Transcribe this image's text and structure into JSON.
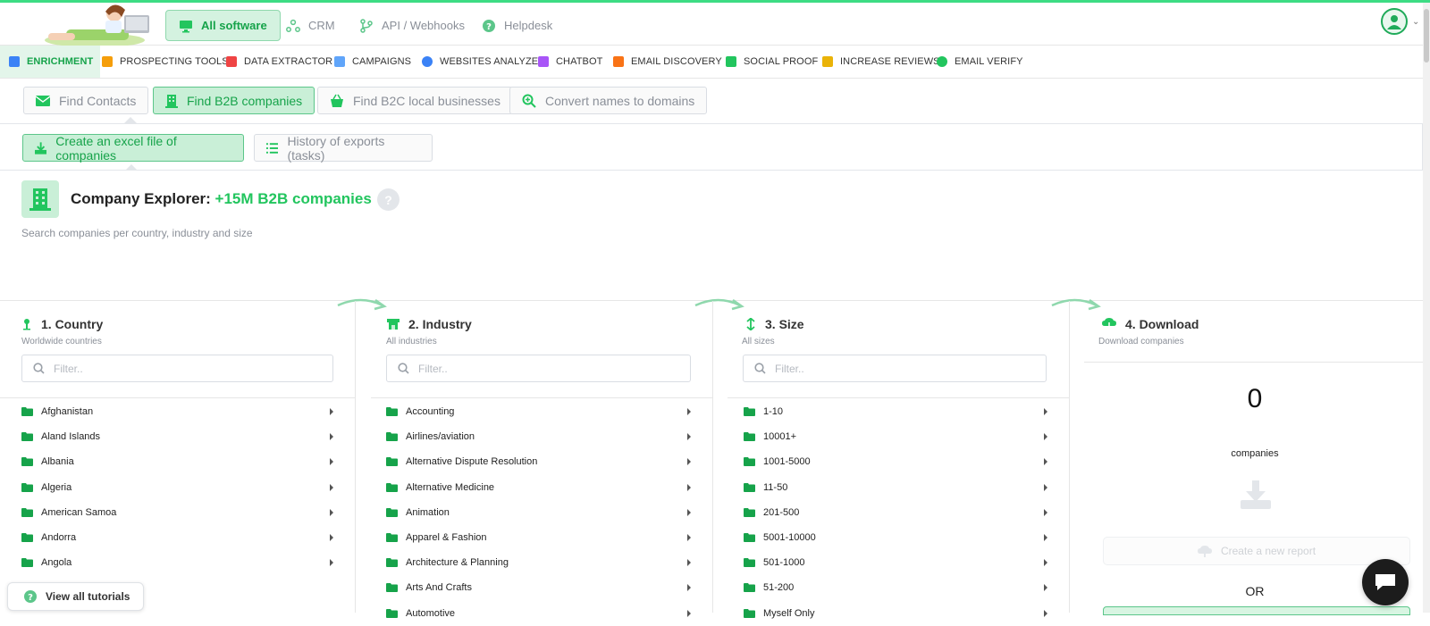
{
  "top_nav": {
    "tabs": [
      {
        "label": "All software",
        "icon": "monitor-icon",
        "active": true
      },
      {
        "label": "CRM",
        "icon": "users-network-icon",
        "active": false
      },
      {
        "label": "API / Webhooks",
        "icon": "branch-icon",
        "active": false
      },
      {
        "label": "Helpdesk",
        "icon": "question-icon",
        "active": false
      }
    ]
  },
  "sub_nav": {
    "items": [
      {
        "label": "ENRICHMENT",
        "color": "#3b82f6",
        "active": true
      },
      {
        "label": "PROSPECTING TOOLS",
        "color": "#f59e0b",
        "active": false
      },
      {
        "label": "DATA EXTRACTOR",
        "color": "#ef4444",
        "active": false
      },
      {
        "label": "CAMPAIGNS",
        "color": "#60a5fa",
        "active": false
      },
      {
        "label": "WEBSITES ANALYZE",
        "color": "#3b82f6",
        "active": false
      },
      {
        "label": "CHATBOT",
        "color": "#a855f7",
        "active": false
      },
      {
        "label": "EMAIL DISCOVERY",
        "color": "#f97316",
        "active": false
      },
      {
        "label": "SOCIAL PROOF",
        "color": "#22c55e",
        "active": false
      },
      {
        "label": "INCREASE REVIEWS",
        "color": "#eab308",
        "active": false
      },
      {
        "label": "EMAIL VERIFY",
        "color": "#22c55e",
        "active": false
      }
    ]
  },
  "tool_buttons": [
    {
      "label": "Find Contacts",
      "active": false
    },
    {
      "label": "Find B2B companies",
      "active": true
    },
    {
      "label": "Find B2C local businesses",
      "active": false
    },
    {
      "label": "Convert names to domains",
      "active": false
    }
  ],
  "action_buttons": [
    {
      "label": "Create an excel file of companies",
      "active": true
    },
    {
      "label": "History of exports (tasks)",
      "active": false
    }
  ],
  "explorer": {
    "title": "Company Explorer:",
    "highlight": "+15M B2B companies",
    "help": "?",
    "subtitle": "Search companies per country, industry and size"
  },
  "columns": {
    "country": {
      "title": "1. Country",
      "subtitle": "Worldwide countries",
      "filter_placeholder": "Filter..",
      "items": [
        "Afghanistan",
        "Aland Islands",
        "Albania",
        "Algeria",
        "American Samoa",
        "Andorra",
        "Angola"
      ]
    },
    "industry": {
      "title": "2. Industry",
      "subtitle": "All industries",
      "filter_placeholder": "Filter..",
      "items": [
        "Accounting",
        "Airlines/aviation",
        "Alternative Dispute Resolution",
        "Alternative Medicine",
        "Animation",
        "Apparel & Fashion",
        "Architecture & Planning",
        "Arts And Crafts",
        "Automotive"
      ]
    },
    "size": {
      "title": "3. Size",
      "subtitle": "All sizes",
      "filter_placeholder": "Filter..",
      "items": [
        "1-10",
        "10001+",
        "1001-5000",
        "11-50",
        "201-500",
        "5001-10000",
        "501-1000",
        "51-200",
        "Myself Only"
      ]
    },
    "download": {
      "title": "4. Download",
      "subtitle": "Download companies",
      "count": "0",
      "count_label": "companies",
      "create_report": "Create a new report",
      "or": "OR"
    }
  },
  "tutorials": {
    "label": "View all tutorials"
  }
}
